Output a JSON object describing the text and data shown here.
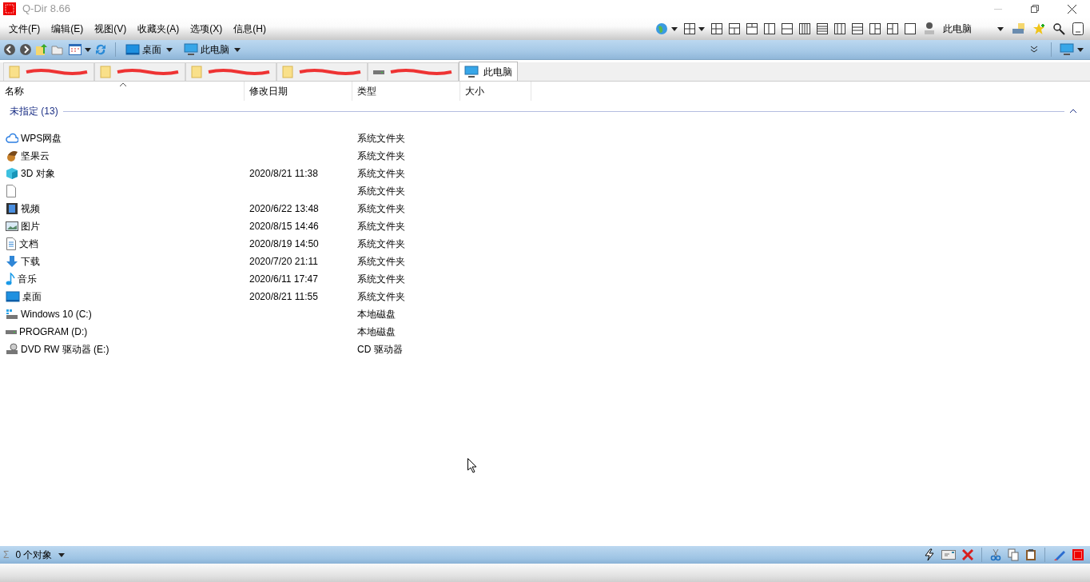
{
  "window": {
    "title": "Q-Dir 8.66"
  },
  "menu": [
    "文件(F)",
    "编辑(E)",
    "视图(V)",
    "收藏夹(A)",
    "选项(X)",
    "信息(H)"
  ],
  "quick_folders": [
    {
      "label": "桌面",
      "kind": "desktop"
    },
    {
      "label": "此电脑",
      "kind": "computer"
    }
  ],
  "location_dropdown": {
    "label": "此电脑"
  },
  "tabs": [
    {
      "kind": "folder",
      "redacted": true,
      "selected": false
    },
    {
      "kind": "folder",
      "redacted": true,
      "selected": false
    },
    {
      "kind": "folder",
      "redacted": true,
      "selected": false
    },
    {
      "kind": "folder",
      "redacted": true,
      "selected": false
    },
    {
      "kind": "drive",
      "redacted": true,
      "selected": false
    },
    {
      "kind": "computer",
      "label": "此电脑",
      "redacted": false,
      "selected": true
    }
  ],
  "table": {
    "columns": [
      "名称",
      "修改日期",
      "类型",
      "大小"
    ],
    "group": "未指定 (13)",
    "rows": [
      {
        "kind": "cloud",
        "name": "WPS网盘",
        "type": "系统文件夹"
      },
      {
        "kind": "nut",
        "name": "坚果云",
        "type": "系统文件夹"
      },
      {
        "kind": "cube",
        "name": "3D 对象",
        "date": "2020/8/21 11:38",
        "type": "系统文件夹"
      },
      {
        "kind": "file",
        "type": "系统文件夹"
      },
      {
        "kind": "film",
        "name": "视频",
        "date": "2020/6/22 13:48",
        "type": "系统文件夹"
      },
      {
        "kind": "image",
        "name": "图片",
        "date": "2020/8/15 14:46",
        "type": "系统文件夹"
      },
      {
        "kind": "doc",
        "name": "文档",
        "date": "2020/8/19 14:50",
        "type": "系统文件夹"
      },
      {
        "kind": "download",
        "name": "下载",
        "date": "2020/7/20 21:11",
        "type": "系统文件夹"
      },
      {
        "kind": "music",
        "name": "音乐",
        "date": "2020/6/11 17:47",
        "type": "系统文件夹"
      },
      {
        "kind": "desktop",
        "name": "桌面",
        "date": "2020/8/21 11:55",
        "type": "系统文件夹"
      },
      {
        "kind": "windrive",
        "name": "Windows 10 (C:)",
        "type": "本地磁盘"
      },
      {
        "kind": "drive",
        "name": "PROGRAM (D:)",
        "type": "本地磁盘"
      },
      {
        "kind": "dvd",
        "name": "DVD RW 驱动器 (E:)",
        "type": "CD 驱动器"
      }
    ]
  },
  "status_bar": {
    "sum_symbol": "Σ",
    "count": "0 个对象"
  }
}
